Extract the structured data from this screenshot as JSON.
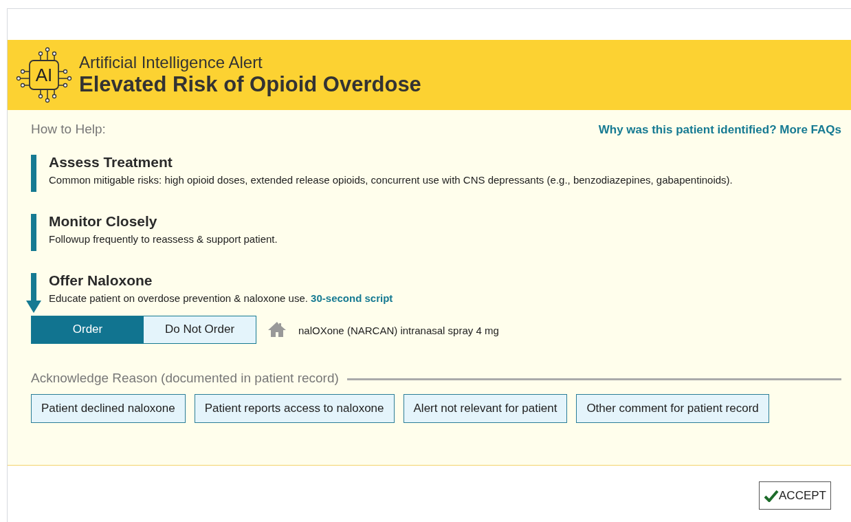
{
  "header": {
    "subtitle": "Artificial Intelligence Alert",
    "title": "Elevated Risk of Opioid Overdose",
    "icon_text": "AI"
  },
  "body": {
    "heading": "How to Help:",
    "faq_link": "Why was this patient identified? More FAQs",
    "sections": [
      {
        "kind": "bar",
        "title": "Assess Treatment",
        "text": "Common mitigable risks: high opioid doses, extended release opioids, concurrent use with CNS depressants (e.g., benzodiazepines, gabapentinoids)."
      },
      {
        "kind": "bar",
        "title": "Monitor Closely",
        "text": "Followup frequently to reassess & support patient."
      },
      {
        "kind": "arrow",
        "title": "Offer Naloxone",
        "text": "Educate patient on overdose prevention & naloxone use.",
        "link": "30-second script"
      }
    ],
    "order_toggle": [
      {
        "label": "Order",
        "selected": true
      },
      {
        "label": "Do Not Order",
        "selected": false
      }
    ],
    "medication": "nalOXone (NARCAN) intranasal spray 4 mg",
    "acknowledge_heading": "Acknowledge Reason (documented in patient record)",
    "reasons": [
      "Patient declined naloxone",
      "Patient reports access to naloxone",
      "Alert not relevant for patient",
      "Other comment for patient record"
    ]
  },
  "footer": {
    "accept": "ACCEPT"
  }
}
